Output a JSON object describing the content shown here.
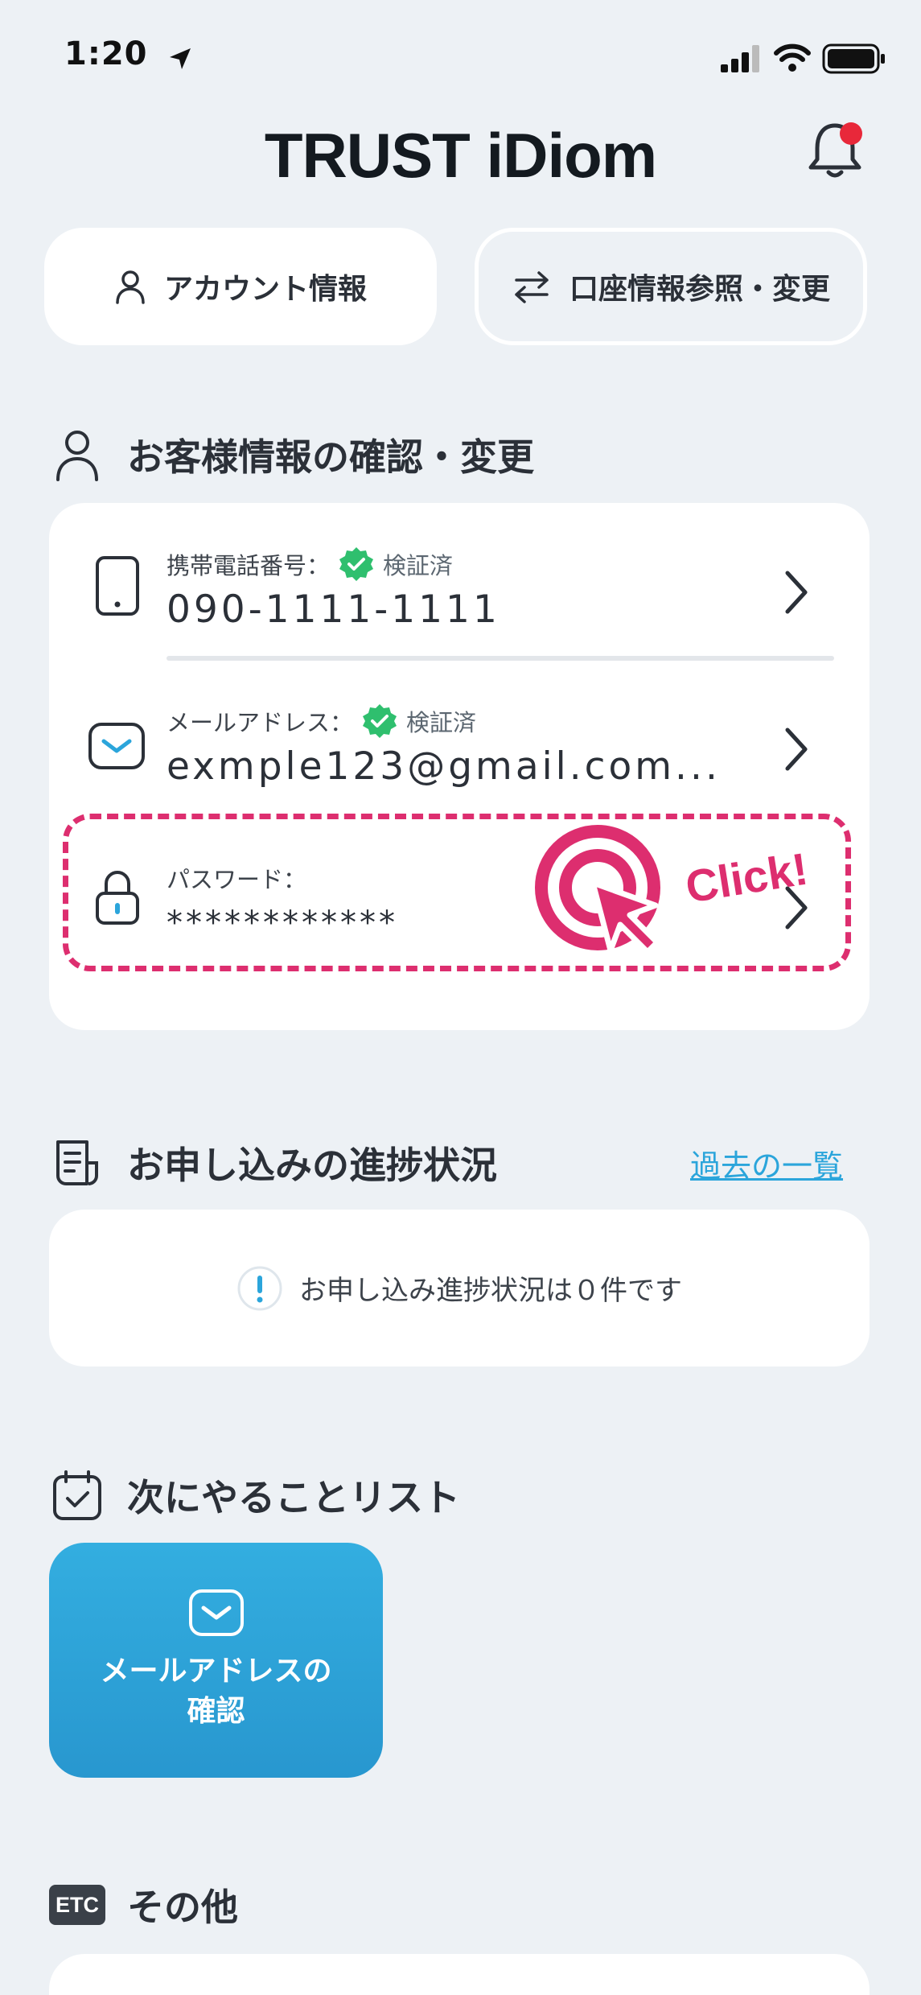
{
  "status_bar": {
    "time": "1:20"
  },
  "header": {
    "logo": "TRUST iDiom",
    "bell_badge_color": "#e8283a"
  },
  "top_buttons": {
    "account": "アカウント情報",
    "bank_account": "口座情報参照・変更"
  },
  "customer_section": {
    "title": "お客様情報の確認・変更",
    "rows": [
      {
        "label": "携帯電話番号：",
        "verified": "検証済",
        "value": "090-1111-1111",
        "icon": "phone-icon"
      },
      {
        "label": "メールアドレス：",
        "verified": "検証済",
        "value": "exmple123@gmail.com...",
        "icon": "mail-icon"
      },
      {
        "label": "パスワード：",
        "value": "************",
        "icon": "lock-icon"
      }
    ],
    "annotation": "Click!"
  },
  "application_section": {
    "title": "お申し込みの進捗状況",
    "link": "過去の一覧",
    "empty_message": "お申し込み進捗状況は０件です"
  },
  "todo_section": {
    "title": "次にやることリスト",
    "card_label_line1": "メールアドレスの",
    "card_label_line2": "確認"
  },
  "other_section": {
    "badge": "ETC",
    "title": "その他"
  },
  "colors": {
    "accent": "#2ba5db",
    "highlight": "#dd2e6f",
    "verified": "#2fbf6e"
  }
}
